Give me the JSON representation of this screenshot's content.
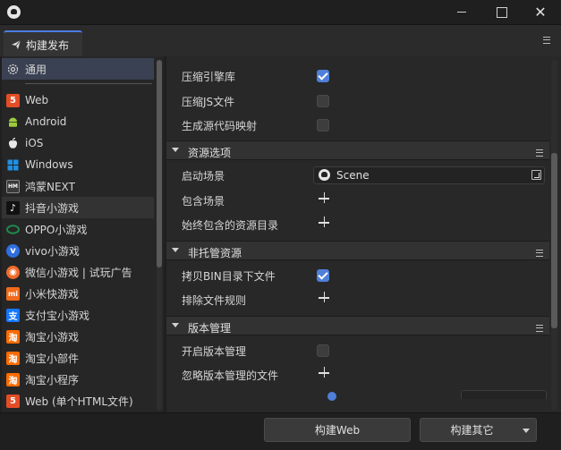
{
  "window": {
    "app_icon": "cocos-logo-icon",
    "controls": [
      "minimize-icon",
      "maximize-icon",
      "close-icon"
    ]
  },
  "tab": {
    "label": "构建发布",
    "icon": "paper-plane-icon"
  },
  "sidebar": {
    "items": [
      {
        "label": "通用",
        "icon": "gear-icon",
        "active": true
      },
      {
        "label": "Web",
        "icon": "html5-icon"
      },
      {
        "label": "Android",
        "icon": "android-icon"
      },
      {
        "label": "iOS",
        "icon": "apple-icon"
      },
      {
        "label": "Windows",
        "icon": "windows-icon"
      },
      {
        "label": "鸿蒙NEXT",
        "icon": "harmonyos-icon"
      },
      {
        "label": "抖音小游戏",
        "icon": "douyin-icon"
      },
      {
        "label": "OPPO小游戏",
        "icon": "oppo-icon"
      },
      {
        "label": "vivo小游戏",
        "icon": "vivo-icon"
      },
      {
        "label": "微信小游戏 | 试玩广告",
        "icon": "wechat-game-icon"
      },
      {
        "label": "小米快游戏",
        "icon": "xiaomi-icon"
      },
      {
        "label": "支付宝小游戏",
        "icon": "alipay-icon"
      },
      {
        "label": "淘宝小游戏",
        "icon": "taobao-icon"
      },
      {
        "label": "淘宝小部件",
        "icon": "taobao-icon"
      },
      {
        "label": "淘宝小程序",
        "icon": "taobao-icon"
      },
      {
        "label": "Web (单个HTML文件)",
        "icon": "html5-icon"
      }
    ]
  },
  "main": {
    "rows_top": [
      {
        "label": "压缩引擎库",
        "control": "checkbox",
        "checked": true
      },
      {
        "label": "压缩JS文件",
        "control": "checkbox",
        "checked": false
      },
      {
        "label": "生成源代码映射",
        "control": "checkbox",
        "checked": false
      }
    ],
    "sections": [
      {
        "title": "资源选项",
        "rows": [
          {
            "label": "启动场景",
            "control": "asset",
            "value": "Scene"
          },
          {
            "label": "包含场景",
            "control": "add"
          },
          {
            "label": "始终包含的资源目录",
            "control": "add"
          }
        ]
      },
      {
        "title": "非托管资源",
        "rows": [
          {
            "label": "拷贝BIN目录下文件",
            "control": "checkbox",
            "checked": true
          },
          {
            "label": "排除文件规则",
            "control": "add"
          }
        ]
      },
      {
        "title": "版本管理",
        "rows": [
          {
            "label": "开启版本管理",
            "control": "checkbox",
            "checked": false
          },
          {
            "label": "忽略版本管理的文件",
            "control": "add"
          }
        ]
      }
    ]
  },
  "footer": {
    "build_web_label": "构建Web",
    "build_other_label": "构建其它"
  },
  "colors": {
    "accent": "#4f7fd9",
    "tab_accent": "#4a7ee0",
    "html5": "#e44d26",
    "android": "#9ccc3c",
    "windows": "#1e90e6",
    "oppo": "#1f8a4c",
    "vivo": "#2f6fe0",
    "wechat_game": "#f06a2a",
    "xiaomi": "#f26a1b",
    "alipay": "#1677ff",
    "taobao": "#ff6a00"
  }
}
